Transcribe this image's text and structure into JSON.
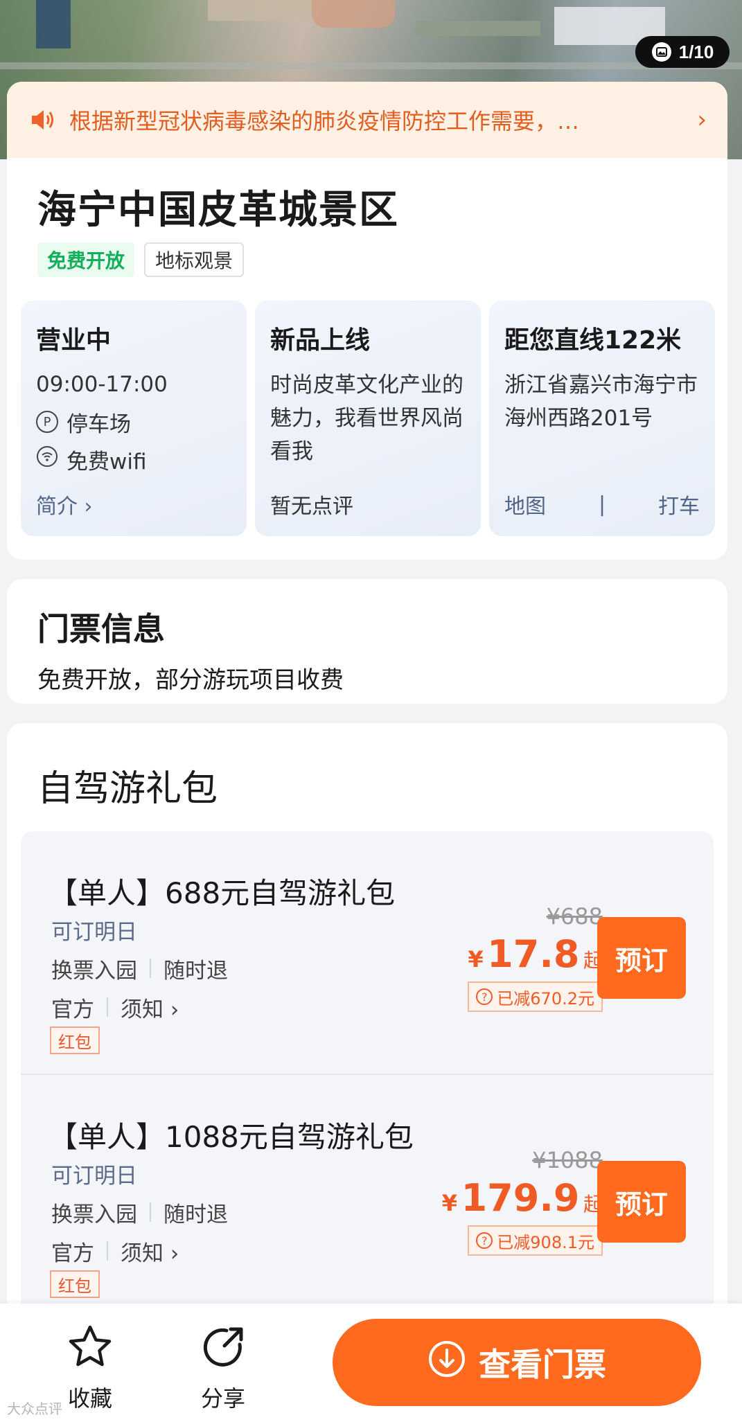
{
  "photo": {
    "counter": "1/10"
  },
  "notice": {
    "text": "根据新型冠状病毒感染的肺炎疫情防控工作需要，…",
    "chevron": "›"
  },
  "scenic": {
    "title": "海宁中国皮革城景区",
    "tags": [
      "免费开放",
      "地标观景"
    ]
  },
  "info": {
    "hours": {
      "status": "营业中",
      "time": "09:00-17:00",
      "parking": "停车场",
      "parking_icon": "P",
      "wifi": "免费wifi",
      "intro": "简介",
      "intro_chev": "›"
    },
    "news": {
      "title": "新品上线",
      "desc": "时尚皮革文化产业的魅力，我看世界风尚看我",
      "reviews": "暂无点评"
    },
    "location": {
      "distance": "距您直线122米",
      "address": "浙江省嘉兴市海宁市海州西路201号",
      "map": "地图",
      "divider": "|",
      "taxi": "打车"
    }
  },
  "tickets": {
    "title": "门票信息",
    "desc": "免费开放，部分游玩项目收费"
  },
  "packages": {
    "title": "自驾游礼包",
    "items": [
      {
        "name": "【单人】688元自驾游礼包",
        "bookable": "可订明日",
        "exchange": "换票入园",
        "refund": "随时退",
        "official": "官方",
        "notice": "须知 ›",
        "redpack": "红包",
        "orig_price": "¥688",
        "currency": "¥",
        "price": "17.8",
        "from": "起",
        "q_icon": "?",
        "saved": "已减670.2元",
        "book": "预订"
      },
      {
        "name": "【单人】1088元自驾游礼包",
        "bookable": "可订明日",
        "exchange": "换票入园",
        "refund": "随时退",
        "official": "官方",
        "notice": "须知 ›",
        "redpack": "红包",
        "orig_price": "¥1088",
        "currency": "¥",
        "price": "179.9",
        "from": "起",
        "q_icon": "?",
        "saved": "已减908.1元",
        "book": "预订"
      }
    ]
  },
  "bottom": {
    "favorite": "收藏",
    "share": "分享",
    "view_tickets": "查看门票"
  },
  "watermark": "大众点评",
  "colors": {
    "accent": "#ff6a1f",
    "price": "#f05a24",
    "free_tag": "#12b05a",
    "notice_bg": "#fff1e3"
  },
  "icons": [
    "picture-icon",
    "speaker-icon",
    "chevron-right-icon",
    "parking-icon",
    "wifi-icon",
    "question-icon",
    "star-icon",
    "share-icon",
    "download-icon"
  ]
}
